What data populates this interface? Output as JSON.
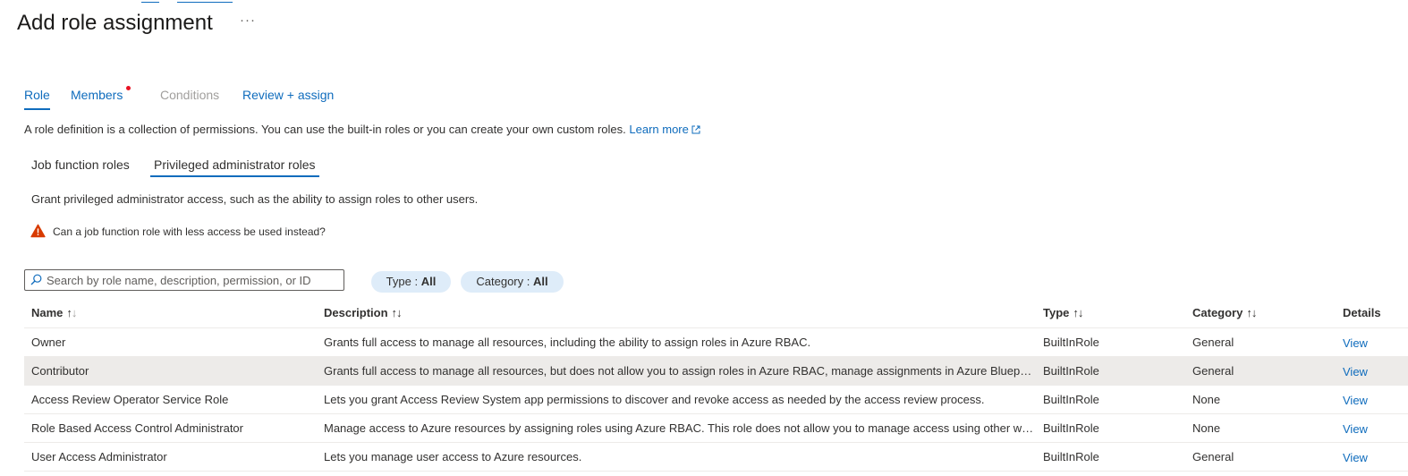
{
  "header": {
    "title": "Add role assignment",
    "more_label": "···"
  },
  "tabs": [
    {
      "label": "Role",
      "state": "active"
    },
    {
      "label": "Members",
      "state": "required"
    },
    {
      "label": "Conditions",
      "state": "disabled"
    },
    {
      "label": "Review + assign",
      "state": "normal"
    }
  ],
  "intro": {
    "text": "A role definition is a collection of permissions. You can use the built-in roles or you can create your own custom roles.",
    "learn_more": "Learn more"
  },
  "pivots": {
    "job_function": "Job function roles",
    "privileged": "Privileged administrator roles"
  },
  "privileged_description": "Grant privileged administrator access, such as the ability to assign roles to other users.",
  "warning": {
    "icon": "warning-icon",
    "text": "Can a job function role with less access be used instead?"
  },
  "search": {
    "placeholder": "Search by role name, description, permission, or ID",
    "value": ""
  },
  "filters": {
    "type": {
      "label": "Type :",
      "value": "All"
    },
    "category": {
      "label": "Category :",
      "value": "All"
    }
  },
  "table": {
    "columns": {
      "name": "Name",
      "description": "Description",
      "type": "Type",
      "category": "Category",
      "details": "Details"
    },
    "rows": [
      {
        "name": "Owner",
        "description": "Grants full access to manage all resources, including the ability to assign roles in Azure RBAC.",
        "type": "BuiltInRole",
        "category": "General",
        "details": "View",
        "selected": false
      },
      {
        "name": "Contributor",
        "description": "Grants full access to manage all resources, but does not allow you to assign roles in Azure RBAC, manage assignments in Azure Blueprints, or share image galleries.",
        "type": "BuiltInRole",
        "category": "General",
        "details": "View",
        "selected": true
      },
      {
        "name": "Access Review Operator Service Role",
        "description": "Lets you grant Access Review System app permissions to discover and revoke access as needed by the access review process.",
        "type": "BuiltInRole",
        "category": "None",
        "details": "View",
        "selected": false
      },
      {
        "name": "Role Based Access Control Administrator",
        "description": "Manage access to Azure resources by assigning roles using Azure RBAC. This role does not allow you to manage access using other ways, such as Azure Policy.",
        "type": "BuiltInRole",
        "category": "None",
        "details": "View",
        "selected": false
      },
      {
        "name": "User Access Administrator",
        "description": "Lets you manage user access to Azure resources.",
        "type": "BuiltInRole",
        "category": "General",
        "details": "View",
        "selected": false
      }
    ]
  },
  "colors": {
    "accent": "#0f6cbd",
    "required_dot": "#e81123",
    "warning": "#d83b01",
    "pill_bg": "#deecf9",
    "selected_row": "#edebe9"
  }
}
